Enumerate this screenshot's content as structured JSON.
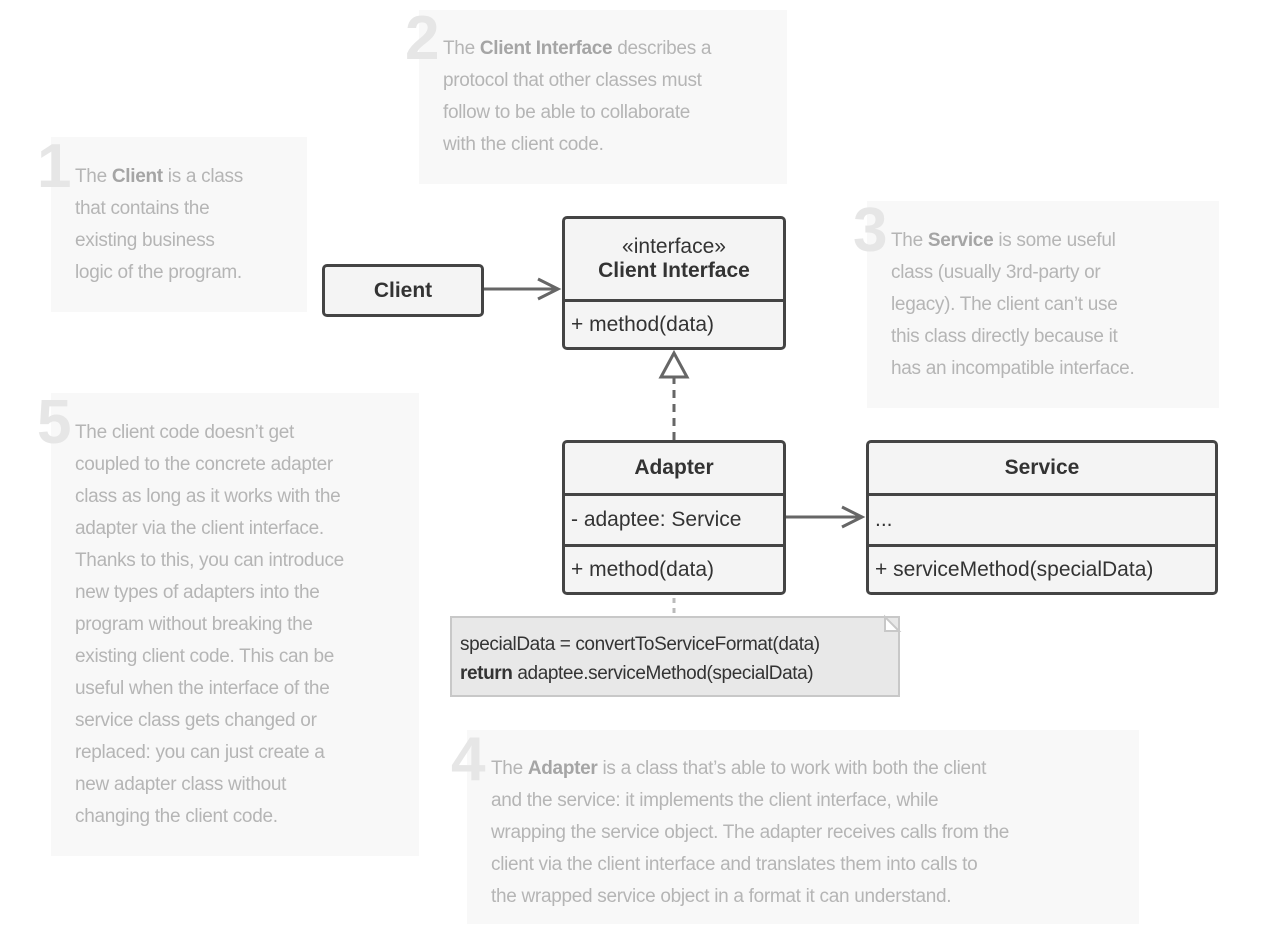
{
  "callouts": [
    {
      "number": "1",
      "parts": [
        "The ",
        "Client",
        " is a class that contains the existing business logic of the program."
      ],
      "lines_html": null
    },
    {
      "number": "2"
    },
    {
      "number": "3"
    },
    {
      "number": "4"
    },
    {
      "number": "5"
    }
  ],
  "c1": {
    "number": "1",
    "l1a": "The ",
    "l1b": "Client",
    "l1c": " is a class",
    "l2": "that contains the",
    "l3": "existing business",
    "l4": "logic of the program."
  },
  "c2": {
    "number": "2",
    "l1a": "The ",
    "l1b": "Client Interface",
    "l1c": " describes a",
    "l2": "protocol that other classes must",
    "l3": "follow to be able to collaborate",
    "l4": "with the client code."
  },
  "c3": {
    "number": "3",
    "l1a": "The ",
    "l1b": "Service",
    "l1c": " is some useful",
    "l2": "class (usually 3rd-party or",
    "l3": "legacy). The client can’t use",
    "l4": "this class directly because it",
    "l5": "has an incompatible interface."
  },
  "c4": {
    "number": "4",
    "l1a": "The ",
    "l1b": "Adapter",
    "l1c": " is a class that’s able to work with both the client",
    "l2": "and the service: it implements the client interface, while",
    "l3": "wrapping the service object. The adapter receives calls from the",
    "l4": "client via the client interface and translates them into calls to",
    "l5": "the wrapped service object in a format it can understand."
  },
  "c5": {
    "number": "5",
    "lines": [
      "The client code doesn’t get",
      "coupled to the concrete adapter",
      "class as long as it works with the",
      "adapter via the client interface.",
      "Thanks to this, you can introduce",
      "new types of adapters into the",
      "program without breaking the",
      "existing client code. This can be",
      "useful when the interface of the",
      "service class gets changed or",
      "replaced: you can just create a",
      "new adapter class without",
      "changing the client code."
    ]
  },
  "uml": {
    "client": {
      "name": "Client"
    },
    "client_interface": {
      "stereotype": "«interface»",
      "name": "Client Interface",
      "method": "+ method(data)"
    },
    "adapter": {
      "name": "Adapter",
      "field": "- adaptee: Service",
      "method": "+ method(data)"
    },
    "service": {
      "name": "Service",
      "field": "...",
      "method": "+ serviceMethod(specialData)"
    },
    "note": {
      "line1": "specialData = convertToServiceFormat(data)",
      "line2_kw": "return",
      "line2": " adaptee.serviceMethod(specialData)"
    }
  }
}
